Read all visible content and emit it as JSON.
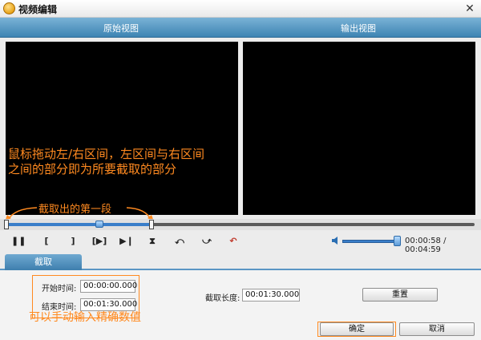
{
  "window": {
    "title": "视频编辑",
    "close_glyph": "✕"
  },
  "views": {
    "source_label": "原始视图",
    "output_label": "输出视图"
  },
  "annotations": {
    "drag_hint_line1": "鼠标拖动左/右区间，左区间与右区间",
    "drag_hint_line2": "之间的部分即为所要截取的部分",
    "first_segment": "截取出的第一段",
    "manual_input": "可以手动输入精确数值"
  },
  "timeline": {
    "selection_fraction": 0.31,
    "playhead_fraction": 0.2
  },
  "controls": {
    "pause": "❚❚",
    "mark_in": "[",
    "mark_out": "]",
    "play_segment": "[▶]",
    "skip_start": "▶❙",
    "cut": "⧗",
    "rotate_left": "⤺",
    "rotate_right": "⤻",
    "undo": "↶",
    "volume_fraction": 1.0,
    "time": "00:00:58 / 00:04:59"
  },
  "tabs": {
    "active": "截取"
  },
  "trim": {
    "start_label": "开始时间:",
    "start_value": "00:00:00.000",
    "end_label": "结束时间:",
    "end_value": "00:01:30.000",
    "length_label": "截取长度:",
    "length_value": "00:01:30.000",
    "reset_label": "重置"
  },
  "footer": {
    "ok_label": "确定",
    "cancel_label": "取消"
  },
  "colors": {
    "annotation": "#ff8a20",
    "header_blue": "#3d84b3",
    "range_blue": "#3a7ec9"
  }
}
